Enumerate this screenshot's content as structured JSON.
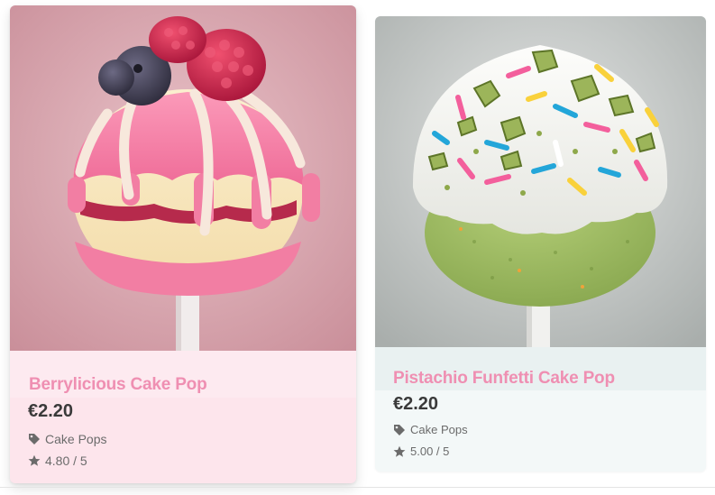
{
  "products": [
    {
      "name": "Berrylicious Cake Pop",
      "price": "€2.20",
      "category": "Cake Pops",
      "rating": "4.80 / 5",
      "image_icon": "berry-cake-pop-photo"
    },
    {
      "name": "Pistachio Funfetti Cake Pop",
      "price": "€2.20",
      "category": "Cake Pops",
      "rating": "5.00 / 5",
      "image_icon": "pistachio-cake-pop-photo"
    }
  ],
  "colors": {
    "title_pink": "#ef8fb2",
    "card1_bg": "#fde5ec",
    "card2_bg": "#f3f8f8",
    "price_text": "#3a3a3a",
    "meta_text": "#6b6b6b"
  }
}
